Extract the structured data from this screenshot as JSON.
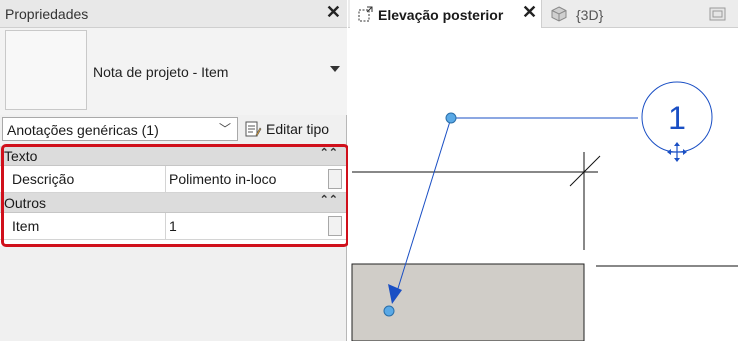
{
  "properties": {
    "title": "Propriedades",
    "type_name": "Nota de projeto - Item",
    "filter_value": "Anotações genéricas (1)",
    "edit_type_label": "Editar tipo",
    "categories": [
      {
        "label": "Texto",
        "rows": [
          {
            "key": "Descrição",
            "value": "Polimento in-loco"
          }
        ]
      },
      {
        "label": "Outros",
        "rows": [
          {
            "key": "Item",
            "value": "1"
          }
        ]
      }
    ],
    "highlight_color": "#d0101b"
  },
  "tabs": [
    {
      "label": "Elevação posterior",
      "active": true,
      "icon": "elevation-view-icon"
    },
    {
      "label": "{3D}",
      "active": false,
      "icon": "3d-view-icon"
    }
  ],
  "canvas": {
    "tag_number": "1",
    "tag_color": "#1a4fc4",
    "leader_color": "#1a4fc4",
    "grip_color": "#5aa9e6",
    "wall_fill": "#d0cdc8"
  }
}
